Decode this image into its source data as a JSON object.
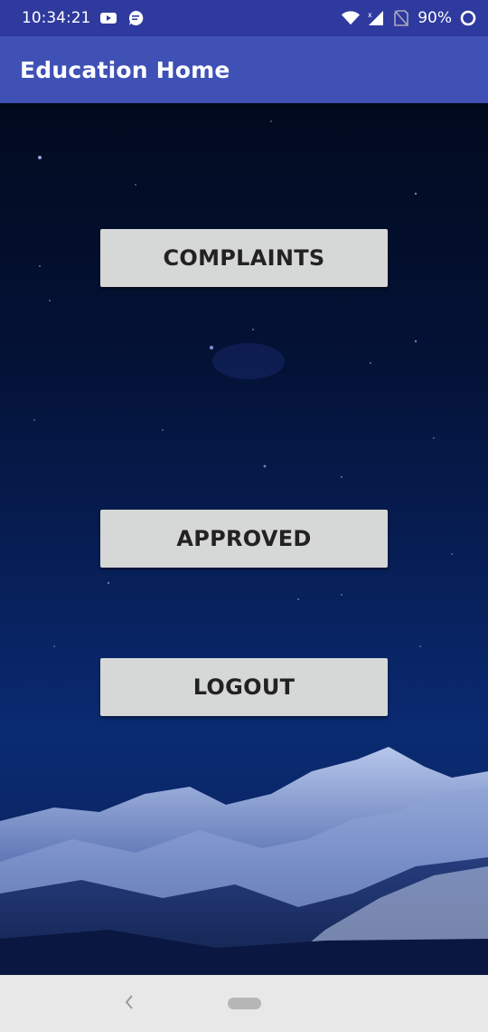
{
  "status_bar": {
    "time": "10:34:21",
    "battery_percent": "90%",
    "icons": [
      "youtube-icon",
      "message-icon",
      "wifi-icon",
      "signal-icon",
      "no-sim-icon",
      "battery-ring-icon"
    ]
  },
  "app_bar": {
    "title": "Education Home",
    "color": "#3f51b5"
  },
  "buttons": {
    "complaints": "COMPLAINTS",
    "approved": "APPROVED",
    "logout": "LOGOUT"
  },
  "nav_bar": {
    "icons": [
      "back-icon",
      "home-pill-icon"
    ]
  },
  "colors": {
    "status_bar": "#2f3a9e",
    "button_bg": "#d6d7d7",
    "nav_bg": "#e8e8e8"
  }
}
